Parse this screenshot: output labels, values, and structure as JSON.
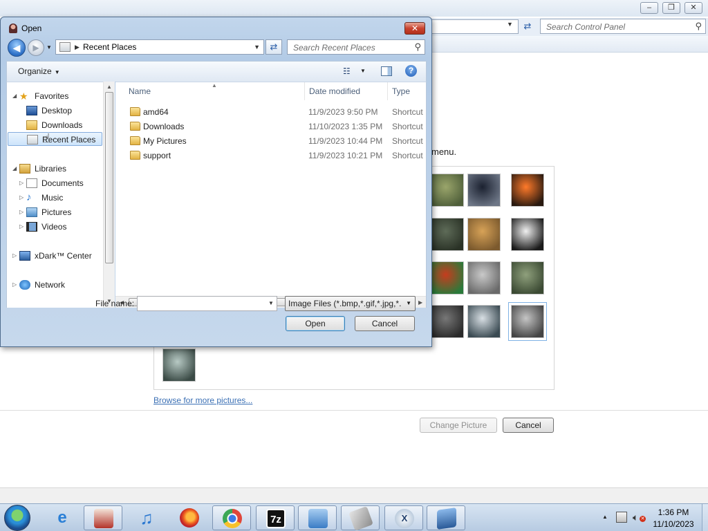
{
  "background_window": {
    "title_buttons": [
      "minimize",
      "restore",
      "close"
    ],
    "search_placeholder": "Search Control Panel",
    "hint_text": "menu.",
    "browse_link": "Browse for more pictures...",
    "change_picture_label": "Change Picture",
    "cancel_label": "Cancel",
    "pictures": [
      {
        "name": "green-field",
        "colors": [
          "#9aa56b",
          "#4f5f3a"
        ]
      },
      {
        "name": "space-planet",
        "colors": [
          "#1b2130",
          "#6d7686"
        ]
      },
      {
        "name": "light-road",
        "colors": [
          "#ff7a2a",
          "#2a1a10"
        ]
      },
      {
        "name": "dark-landscape",
        "colors": [
          "#5e6b58",
          "#2a3226"
        ]
      },
      {
        "name": "melting-clock",
        "colors": [
          "#d7a257",
          "#7c5a2e"
        ]
      },
      {
        "name": "creature-sketch",
        "colors": [
          "#f0f0f0",
          "#1a1a1a"
        ]
      },
      {
        "name": "swirl-planet",
        "colors": [
          "#c63c1e",
          "#2a7a3a"
        ]
      },
      {
        "name": "eye-closeup",
        "colors": [
          "#c9c9c9",
          "#6a6a6a"
        ]
      },
      {
        "name": "ruins-scene",
        "colors": [
          "#8fa07c",
          "#3b4a33"
        ]
      },
      {
        "name": "chair-room",
        "colors": [
          "#777777",
          "#2a2a2a"
        ]
      },
      {
        "name": "surreal-figure",
        "colors": [
          "#d8dfe4",
          "#3a4a52"
        ]
      },
      {
        "name": "man-portrait",
        "colors": [
          "#c5c5c5",
          "#444444"
        ]
      },
      {
        "name": "glass-cube",
        "colors": [
          "#b7c9c4",
          "#3a4a45"
        ]
      }
    ],
    "selected_picture": "man-portrait"
  },
  "dialog": {
    "title": "Open",
    "close_glyph": "✕",
    "address": "Recent Places",
    "search_placeholder": "Search Recent Places",
    "organize_label": "Organize",
    "nav": {
      "favorites": "Favorites",
      "desktop": "Desktop",
      "downloads": "Downloads",
      "recent_places": "Recent Places",
      "libraries": "Libraries",
      "documents": "Documents",
      "music": "Music",
      "pictures": "Pictures",
      "videos": "Videos",
      "computer": "xDark™ Center",
      "network": "Network"
    },
    "columns": {
      "name": "Name",
      "date": "Date modified",
      "type": "Type"
    },
    "files": [
      {
        "name": "amd64",
        "date": "11/9/2023 9:50 PM",
        "type": "Shortcut",
        "icon": "folder-icon"
      },
      {
        "name": "Downloads",
        "date": "11/10/2023 1:35 PM",
        "type": "Shortcut",
        "icon": "downloads-folder-icon"
      },
      {
        "name": "My Pictures",
        "date": "11/9/2023 10:44 PM",
        "type": "Shortcut",
        "icon": "pictures-folder-icon"
      },
      {
        "name": "support",
        "date": "11/9/2023 10:21 PM",
        "type": "Shortcut",
        "icon": "folder-icon"
      }
    ],
    "file_name_label": "File name:",
    "file_name_value": "",
    "file_type": "Image Files (*.bmp,*.gif,*.jpg,*.",
    "open_label": "Open",
    "cancel_label": "Cancel"
  },
  "taskbar": {
    "apps": [
      "internet-explorer",
      "media-app",
      "itunes",
      "firefox",
      "chrome",
      "7zip",
      "control-panel",
      "app-8",
      "app-9",
      "app-10"
    ],
    "clock_time": "1:36 PM",
    "clock_date": "11/10/2023"
  }
}
